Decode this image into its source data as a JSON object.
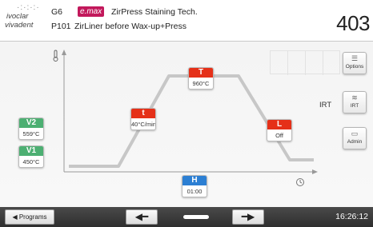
{
  "header": {
    "logo_line1": "ivoclar",
    "logo_line2": "vivadent",
    "program_code": "G6",
    "brand_badge": "e.max",
    "program_title": "ZirPress Staining Tech.",
    "program_number": "P101",
    "program_description": "ZirLiner before Wax-up+Press",
    "temperature": "403"
  },
  "chart": {
    "thermometer_icon": "thermometer-icon",
    "clock_icon": "clock-icon",
    "params": {
      "V2": {
        "label": "V2",
        "value": "559°C",
        "color": "#4caf72"
      },
      "V1": {
        "label": "V1",
        "value": "450°C",
        "color": "#4caf72"
      },
      "t": {
        "label": "t",
        "value": "40°C/min",
        "color": "#e53018"
      },
      "T": {
        "label": "T",
        "value": "960°C",
        "color": "#e53018"
      },
      "L": {
        "label": "L",
        "value": "Off",
        "color": "#e53018"
      },
      "H": {
        "label": "H",
        "value": "01:00",
        "color": "#2c7fd3"
      }
    }
  },
  "sidebar": {
    "options_label": "Options",
    "irt_text": "IRT",
    "irt_button_label": "IRT",
    "admin_label": "Admin"
  },
  "footer": {
    "programs_label": "Programs",
    "time": "16:26:12"
  }
}
